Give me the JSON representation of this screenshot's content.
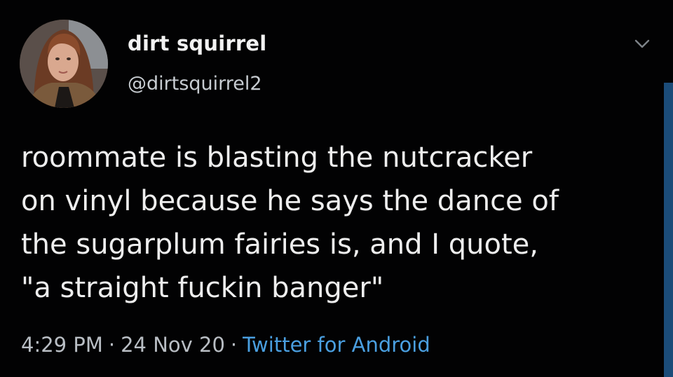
{
  "tweet": {
    "display_name": "dirt squirrel",
    "handle": "@dirtsquirrel2",
    "text_lines": [
      "roommate is blasting the nutcracker",
      "on vinyl because he says the dance of",
      "the sugarplum fairies is, and I quote,",
      "\"a straight fuckin banger\""
    ],
    "time": "4:29 PM",
    "separator": "·",
    "date": "24 Nov 20",
    "source": "Twitter for Android",
    "avatar_icon": "profile-photo",
    "menu_icon": "chevron-down-icon"
  },
  "colors": {
    "background": "#020203",
    "text": "#eeeeee",
    "secondary": "#b9bec4",
    "link": "#4a9fe0",
    "scrollbar": "#1b4c79"
  }
}
